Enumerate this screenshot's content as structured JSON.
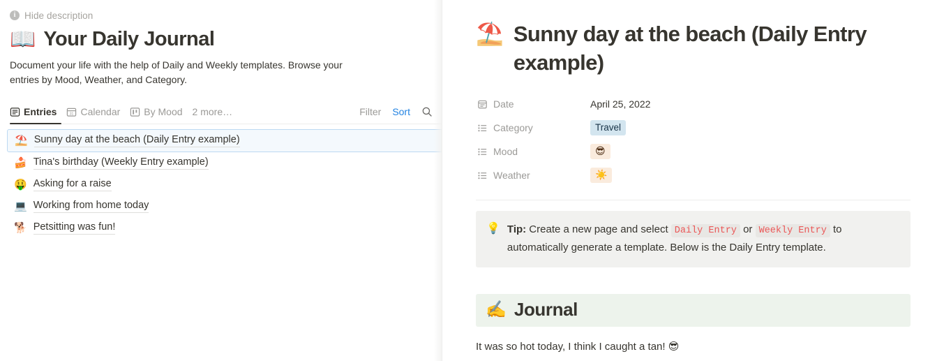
{
  "left": {
    "hide_description": {
      "label": "Hide description",
      "icon": "info-circle-icon"
    },
    "page_title": {
      "emoji": "📖",
      "text": "Your Daily Journal"
    },
    "description": "Document your life with the help of Daily and Weekly templates. Browse your entries by Mood, Weather, and Category.",
    "tabs": [
      {
        "label": "Entries",
        "icon": "table-view-icon",
        "active": true
      },
      {
        "label": "Calendar",
        "icon": "calendar-view-icon",
        "active": false
      },
      {
        "label": "By Mood",
        "icon": "board-view-icon",
        "active": false
      },
      {
        "label": "2 more…",
        "icon": "",
        "active": false
      }
    ],
    "actions": {
      "filter_label": "Filter",
      "sort_label": "Sort",
      "sort_color": "#2383e2",
      "search_icon": "search-icon"
    },
    "entries": [
      {
        "emoji": "⛱️",
        "title": "Sunny day at the beach (Daily Entry example)",
        "selected": true
      },
      {
        "emoji": "🍰",
        "title": "Tina's birthday (Weekly Entry example)",
        "selected": false
      },
      {
        "emoji": "🤑",
        "title": "Asking for a raise",
        "selected": false
      },
      {
        "emoji": "💻",
        "title": "Working from home today",
        "selected": false
      },
      {
        "emoji": "🐕",
        "title": "Petsitting was fun!",
        "selected": false
      }
    ]
  },
  "right": {
    "title": {
      "emoji": "⛱️",
      "text": "Sunny day at the beach (Daily Entry example)"
    },
    "properties": [
      {
        "icon": "date-property-icon",
        "label": "Date",
        "value": "April 25, 2022",
        "style": "plain"
      },
      {
        "icon": "select-property-icon",
        "label": "Category",
        "value": "Travel",
        "style": "tag-blue"
      },
      {
        "icon": "select-property-icon",
        "label": "Mood",
        "value": "😎",
        "style": "tag-orange"
      },
      {
        "icon": "select-property-icon",
        "label": "Weather",
        "value": "☀️",
        "style": "tag-orange"
      }
    ],
    "callout": {
      "icon": "lightbulb-icon",
      "bold_lead": "Tip:",
      "text_1": " Create a new page and select ",
      "code_1": "Daily Entry",
      "text_2": " or ",
      "code_2": "Weekly Entry",
      "text_3": " to automatically generate a template. Below is the Daily Entry template.",
      "background": "#f1f1ef",
      "code_color": "#eb5757"
    },
    "journal_heading": {
      "emoji": "✍️",
      "text": "Journal",
      "background": "#edf3ec"
    },
    "journal_body": "It was so hot today, I think I caught a tan! 😎"
  }
}
